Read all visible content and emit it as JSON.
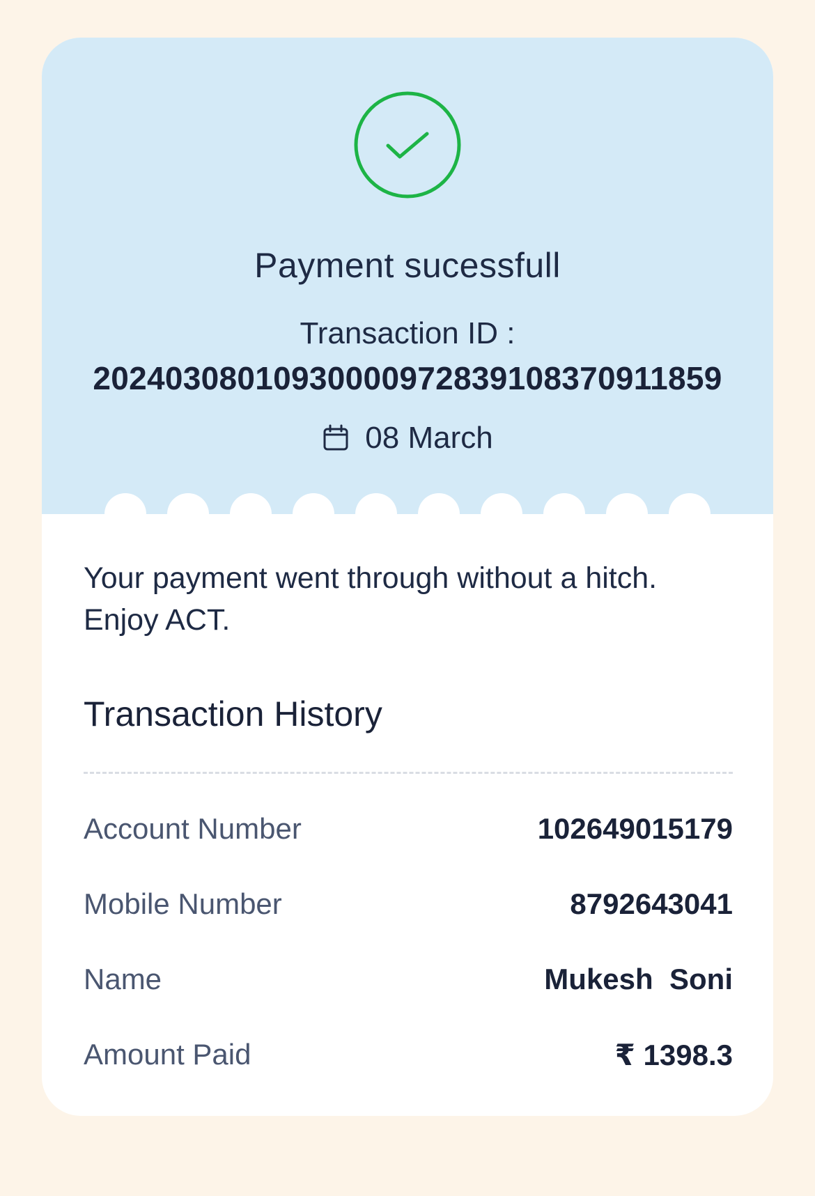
{
  "status": {
    "title": "Payment sucessfull",
    "icon": "check-circle-icon",
    "accent_color": "#1DB446"
  },
  "transaction": {
    "id_label": "Transaction ID :",
    "id_value": "20240308010930000972839108370911859",
    "date": "08 March"
  },
  "message": {
    "line1": "Your payment went through without a hitch.",
    "line2": "Enjoy ACT."
  },
  "history": {
    "title": "Transaction History",
    "rows": [
      {
        "label": "Account Number",
        "value": "102649015179"
      },
      {
        "label": "Mobile Number",
        "value": "8792643041"
      },
      {
        "label": "Name",
        "value": "Mukesh  Soni"
      },
      {
        "label": "Amount Paid",
        "value": "₹ 1398.3"
      }
    ]
  },
  "colors": {
    "page_background": "#FDF4E8",
    "header_background": "#D4EAF7",
    "card_background": "#FFFFFF",
    "text_primary": "#1E2A44"
  }
}
